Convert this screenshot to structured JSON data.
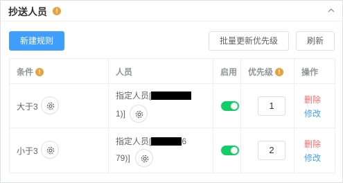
{
  "header": {
    "title": "抄送人员",
    "info": "!"
  },
  "toolbar": {
    "new_rule": "新建规则",
    "batch_update": "批量更新优先级",
    "refresh": "刷新"
  },
  "table": {
    "columns": {
      "condition": "条件",
      "person": "人员",
      "enabled": "启用",
      "priority": "优先级",
      "action": "操作"
    },
    "rows": [
      {
        "condition": "大于3",
        "person_prefix": "指定人员[",
        "person_suffix": "1)]",
        "enabled": true,
        "priority": "1",
        "delete": "删除",
        "edit": "修改"
      },
      {
        "condition": "小于3",
        "person_prefix": "指定人员[",
        "person_mid": "6",
        "person_suffix": "79)]",
        "enabled": true,
        "priority": "2",
        "delete": "删除",
        "edit": "修改"
      }
    ]
  },
  "colors": {
    "primary": "#409eff",
    "danger": "#f56c6c",
    "success": "#13ce66",
    "warning": "#e6a23c"
  },
  "icons": {
    "info": "info-icon",
    "gear": "gear-icon",
    "collapse": "chevron-up-icon"
  }
}
